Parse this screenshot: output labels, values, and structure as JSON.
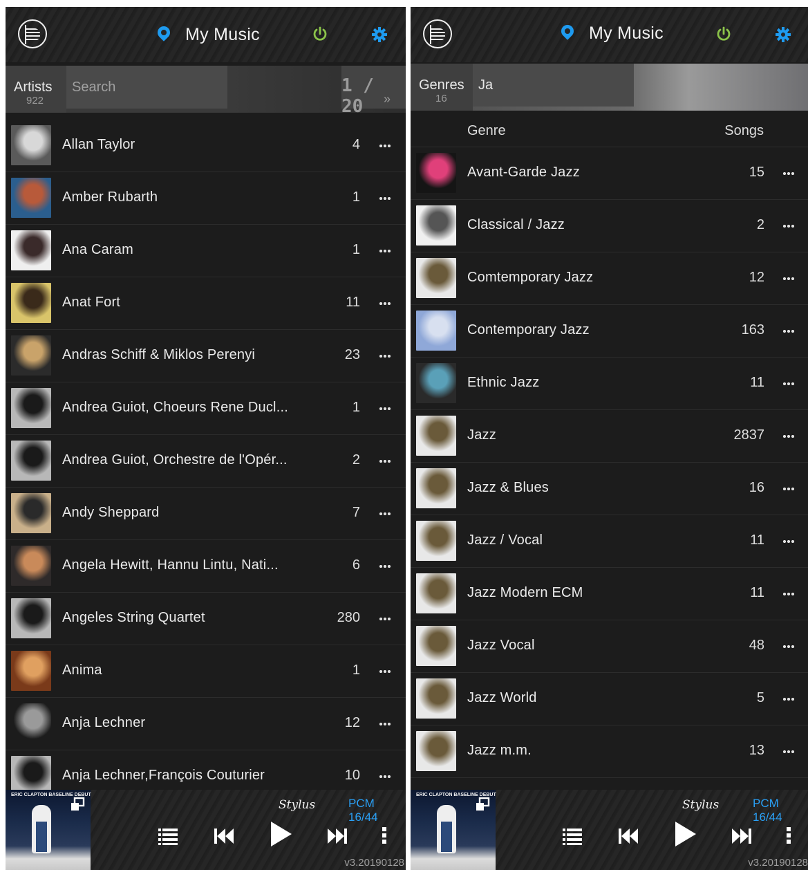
{
  "header": {
    "title": "My Music"
  },
  "left": {
    "category_label": "Artists",
    "category_count": "922",
    "search_placeholder": "Search",
    "search_value": "",
    "pager": "1 / 20",
    "pager_next": "»",
    "rows": [
      {
        "name": "Allan Taylor",
        "count": "4",
        "thumb": [
          "#5a5a5a",
          "#d8d8d8"
        ]
      },
      {
        "name": "Amber Rubarth",
        "count": "1",
        "thumb": [
          "#2b5e8e",
          "#b85a3a"
        ]
      },
      {
        "name": "Ana Caram",
        "count": "1",
        "thumb": [
          "#efefef",
          "#3a2a2a"
        ]
      },
      {
        "name": "Anat Fort",
        "count": "11",
        "thumb": [
          "#d9c46a",
          "#3a2a1a"
        ]
      },
      {
        "name": "Andras Schiff & Miklos Perenyi",
        "count": "23",
        "thumb": [
          "#2b2b2b",
          "#c9a36a"
        ]
      },
      {
        "name": "Andrea Guiot, Choeurs Rene Ducl...",
        "count": "1",
        "thumb": [
          "#b8b8b8",
          "#1a1a1a"
        ]
      },
      {
        "name": "Andrea Guiot, Orchestre de l'Opér...",
        "count": "2",
        "thumb": [
          "#b8b8b8",
          "#1a1a1a"
        ]
      },
      {
        "name": "Andy Sheppard",
        "count": "7",
        "thumb": [
          "#c9b08a",
          "#2a2a2a"
        ]
      },
      {
        "name": "Angela Hewitt, Hannu Lintu, Nati...",
        "count": "6",
        "thumb": [
          "#2e2a2a",
          "#c98a5a"
        ]
      },
      {
        "name": "Angeles String Quartet",
        "count": "280",
        "thumb": [
          "#b8b8b8",
          "#1a1a1a"
        ]
      },
      {
        "name": "Anima",
        "count": "1",
        "thumb": [
          "#7a3a1a",
          "#e0a060"
        ]
      },
      {
        "name": "Anja Lechner",
        "count": "12",
        "thumb": [
          "#1c1c1c",
          "#9a9a9a"
        ]
      },
      {
        "name": "Anja Lechner,François Couturier",
        "count": "10",
        "thumb": [
          "#b8b8b8",
          "#1a1a1a"
        ]
      }
    ]
  },
  "right": {
    "category_label": "Genres",
    "category_count": "16",
    "search_value": "Ja",
    "col_genre": "Genre",
    "col_songs": "Songs",
    "rows": [
      {
        "name": "Avant-Garde Jazz",
        "count": "15",
        "thumb": [
          "#151515",
          "#e0407a"
        ]
      },
      {
        "name": "Classical / Jazz",
        "count": "2",
        "thumb": [
          "#f0f0f0",
          "#555555"
        ]
      },
      {
        "name": "Comtemporary Jazz",
        "count": "12",
        "thumb": [
          "#e8e8e8",
          "#6a5a3a"
        ]
      },
      {
        "name": "Contemporary Jazz",
        "count": "163",
        "thumb": [
          "#8fa8d8",
          "#d8e0f0"
        ]
      },
      {
        "name": "Ethnic Jazz",
        "count": "11",
        "thumb": [
          "#2a2a2a",
          "#5aa0b8"
        ]
      },
      {
        "name": "Jazz",
        "count": "2837",
        "thumb": [
          "#e8e8e8",
          "#6a5a3a"
        ]
      },
      {
        "name": "Jazz & Blues",
        "count": "16",
        "thumb": [
          "#e8e8e8",
          "#6a5a3a"
        ]
      },
      {
        "name": "Jazz / Vocal",
        "count": "11",
        "thumb": [
          "#e8e8e8",
          "#6a5a3a"
        ]
      },
      {
        "name": "Jazz Modern ECM",
        "count": "11",
        "thumb": [
          "#e8e8e8",
          "#6a5a3a"
        ]
      },
      {
        "name": "Jazz Vocal",
        "count": "48",
        "thumb": [
          "#e8e8e8",
          "#6a5a3a"
        ]
      },
      {
        "name": "Jazz World",
        "count": "5",
        "thumb": [
          "#e8e8e8",
          "#6a5a3a"
        ]
      },
      {
        "name": "Jazz m.m.",
        "count": "13",
        "thumb": [
          "#e8e8e8",
          "#6a5a3a"
        ]
      }
    ]
  },
  "player": {
    "cover_text": "ERIC CLAPTON BASELINE DEBUT",
    "brand": "Stylus",
    "format": "PCM 16/44",
    "version": "v3.20190128"
  },
  "colors": {
    "accent_blue": "#1e9bf0",
    "power_green": "#8bc34a",
    "panel_bg": "#1c1c1c"
  },
  "icons": [
    "logo-icon",
    "location-pin-icon",
    "power-icon",
    "gear-icon",
    "more-horizontal-icon",
    "expand-window-icon",
    "queue-list-icon",
    "skip-previous-icon",
    "play-icon",
    "skip-next-icon",
    "more-vertical-icon"
  ]
}
